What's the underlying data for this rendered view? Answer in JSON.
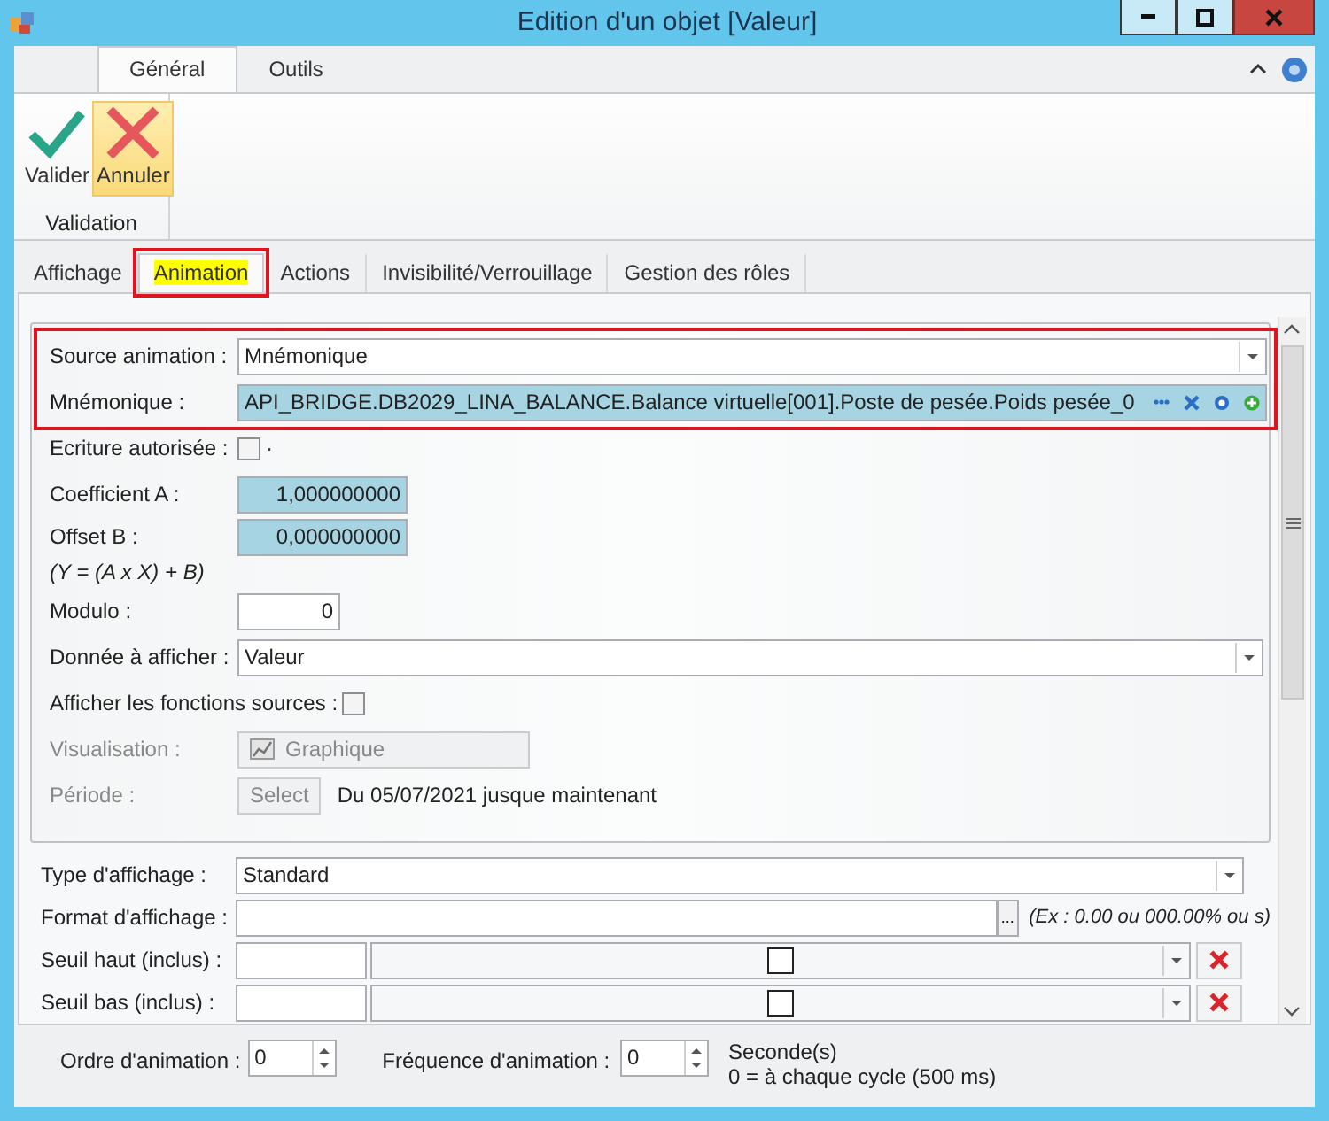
{
  "window": {
    "title": "Edition d'un objet [Valeur]"
  },
  "ribbon": {
    "tabs": [
      {
        "label": "Général",
        "selected": true
      },
      {
        "label": "Outils",
        "selected": false
      }
    ],
    "buttons": [
      {
        "label": "Valider",
        "kind": "check",
        "highlighted": false
      },
      {
        "label": "Annuler",
        "kind": "cross",
        "highlighted": true
      }
    ],
    "group": "Validation"
  },
  "tabs": [
    {
      "label": "Affichage",
      "selected": false,
      "annotated": false
    },
    {
      "label": "Animation",
      "selected": true,
      "annotated": true
    },
    {
      "label": "Actions",
      "selected": false,
      "annotated": false
    },
    {
      "label": "Invisibilité/Verrouillage",
      "selected": false,
      "annotated": false
    },
    {
      "label": "Gestion des rôles",
      "selected": false,
      "annotated": false
    }
  ],
  "animation": {
    "rows": [
      {
        "kind": "select",
        "label": "Source animation :",
        "value": "Mnémonique",
        "annotated": true
      },
      {
        "kind": "mnemonic",
        "label": "Mnémonique :",
        "value": "API_BRIDGE.DB2029_LINA_BALANCE.Balance virtuelle[001].Poste de pesée.Poids pesée_0",
        "annotated": true
      },
      {
        "kind": "checkbox",
        "label": "Ecriture autorisée :",
        "checked": false,
        "suffix": "·"
      },
      {
        "kind": "number",
        "label": "Coefficient A :",
        "value": "1,000000000",
        "tinted": true
      },
      {
        "kind": "number",
        "label": "Offset B :",
        "value": "0,000000000",
        "tinted": true
      },
      {
        "kind": "note",
        "text": "(Y = (A x X) + B)"
      },
      {
        "kind": "short",
        "label": "Modulo :",
        "value": "0"
      },
      {
        "kind": "select",
        "label": "Donnée à afficher :",
        "value": "Valeur"
      },
      {
        "kind": "checkbox",
        "label": "Afficher les fonctions sources :",
        "checked": false
      },
      {
        "kind": "chart-button",
        "label": "Visualisation :",
        "button": "Graphique",
        "disabled": true
      },
      {
        "kind": "period",
        "label": "Période :",
        "button": "Select",
        "text": "Du 05/07/2021 jusque maintenant",
        "disabled": true
      }
    ]
  },
  "display": {
    "rows": [
      {
        "kind": "select",
        "label": "Type d'affichage :",
        "value": "Standard"
      },
      {
        "kind": "format",
        "label": "Format d'affichage :",
        "button": "...",
        "hint": "(Ex : 0.00 ou 000.00% ou s)"
      },
      {
        "kind": "threshold",
        "label": "Seuil haut (inclus) :"
      },
      {
        "kind": "threshold",
        "label": "Seuil bas (inclus) :"
      }
    ]
  },
  "footer": {
    "order": {
      "label": "Ordre d'animation :",
      "value": "0"
    },
    "frequency": {
      "label": "Fréquence d'animation :",
      "value": "0"
    },
    "unit": "Seconde(s)",
    "note": "0 = à chaque cycle (500 ms)"
  }
}
